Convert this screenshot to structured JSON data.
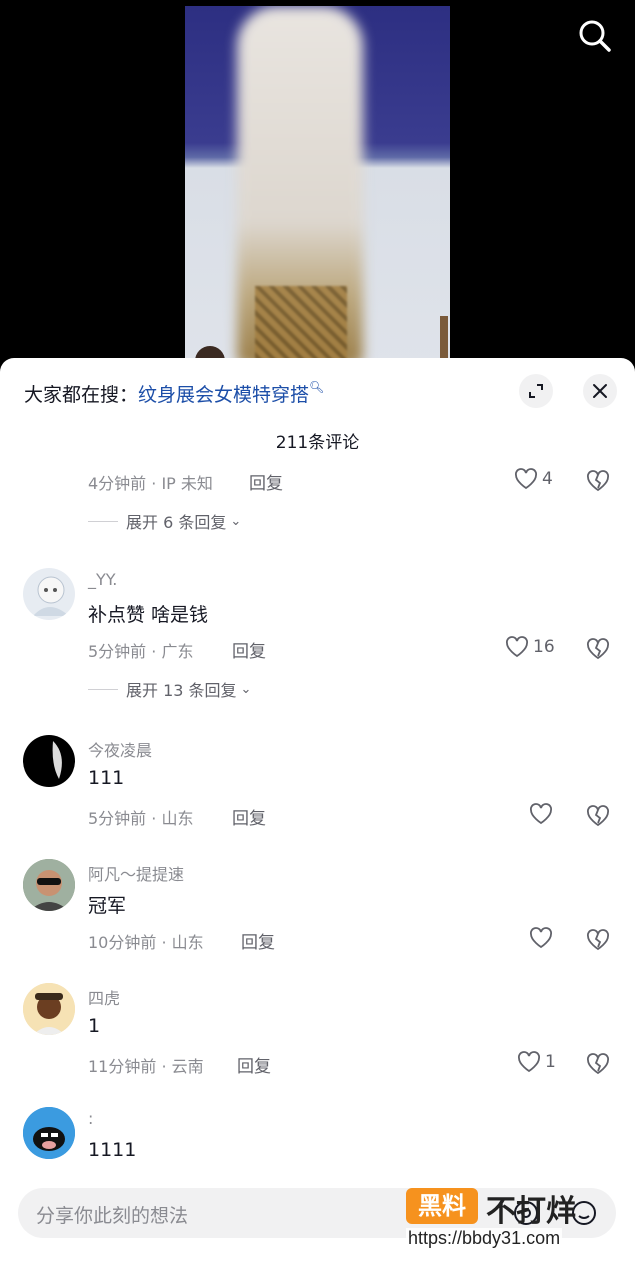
{
  "header": {
    "search_icon": "search-icon"
  },
  "sheet": {
    "search_prefix": "大家都在搜：",
    "search_keyword": "纹身展会女模特穿搭",
    "comment_count": "211条评论"
  },
  "comments": [
    {
      "meta": "4分钟前 · IP 未知",
      "reply": "回复",
      "likes": "4",
      "expand": "展开 6 条回复"
    },
    {
      "username": "_YY.",
      "text": "补点赞 啥是钱",
      "meta": "5分钟前 · 广东",
      "reply": "回复",
      "likes": "16",
      "expand": "展开 13 条回复"
    },
    {
      "username": "今夜凌晨",
      "text": "111",
      "meta": "5分钟前 · 山东",
      "reply": "回复",
      "likes": ""
    },
    {
      "username": "阿凡～提提速",
      "text": "冠军",
      "meta": "10分钟前 · 山东",
      "reply": "回复",
      "likes": ""
    },
    {
      "username": "四虎",
      "text": "1",
      "meta": "11分钟前 · 云南",
      "reply": "回复",
      "likes": "1"
    },
    {
      "username": ":",
      "text": "1111"
    }
  ],
  "input": {
    "placeholder": "分享你此刻的想法"
  },
  "watermark": {
    "badge": "黑料",
    "text": "不打烊",
    "url": "https://bbdy31.com"
  },
  "colors": {
    "keyword": "#1c4ea8",
    "sheet_bg": "#ffffff",
    "muted": "#8a8b91"
  }
}
